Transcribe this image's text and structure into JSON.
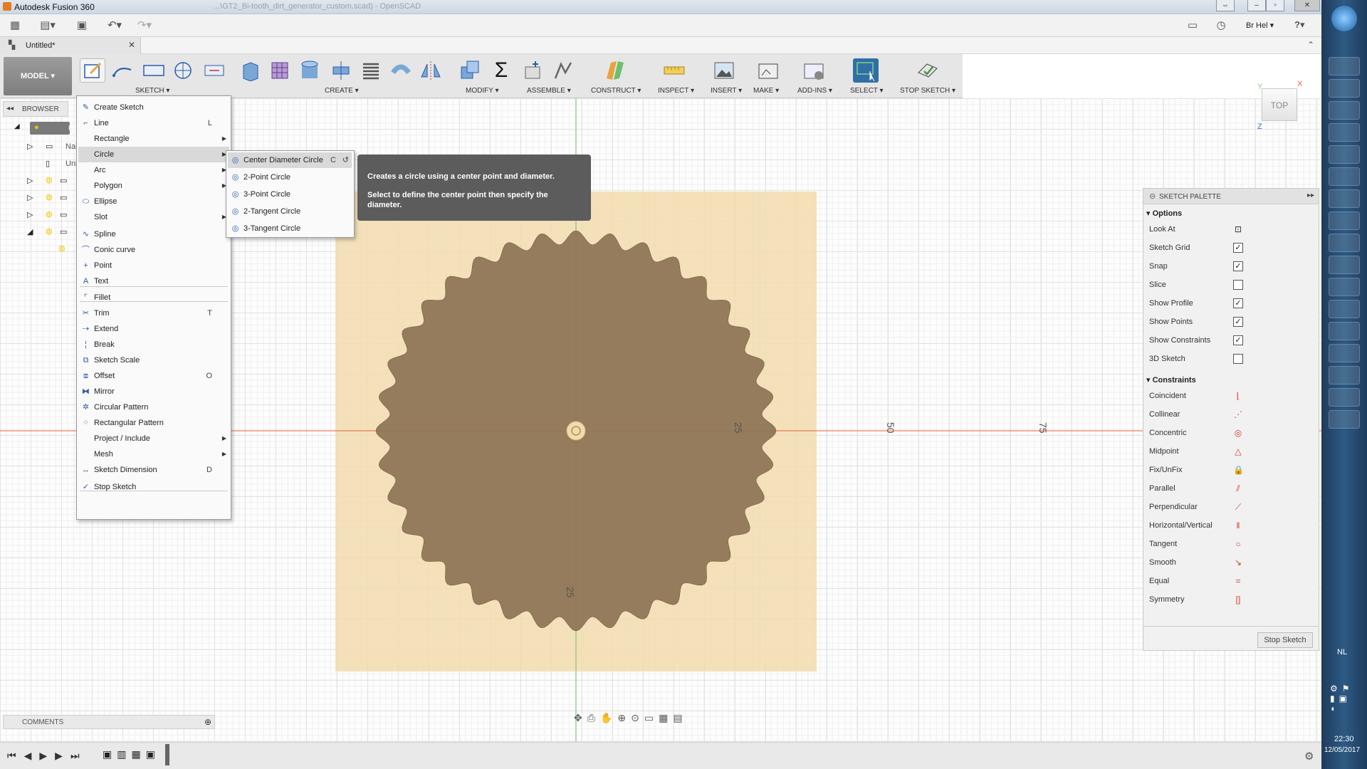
{
  "window": {
    "title": "Autodesk Fusion 360",
    "subtitle_faded": "...\\GT2_Bi-tooth_dirt_generator_custom.scad) - OpenSCAD",
    "restore_icon": "restore-icon",
    "minimize_icon": "minimize-icon",
    "maximize_icon": "maximize-icon",
    "close_icon": "close-icon"
  },
  "qat": {
    "user": "Br Hel ▾",
    "help": "?▾"
  },
  "document": {
    "tab": "Untitled*",
    "close": "✕"
  },
  "toolbar": {
    "workspace": "MODEL",
    "groups": [
      "SKETCH ▾",
      "CREATE ▾",
      "MODIFY ▾",
      "ASSEMBLE ▾",
      "CONSTRUCT ▾",
      "INSPECT ▾",
      "INSERT ▾",
      "MAKE ▾",
      "ADD-INS ▾",
      "SELECT ▾",
      "STOP SKETCH ▾"
    ]
  },
  "browser": {
    "title": "BROWSER",
    "row0": "(U",
    "row1": "Nai",
    "row2": "Uni"
  },
  "sketch_menu": {
    "items": [
      {
        "label": "Create Sketch",
        "shortcut": "",
        "icon": "create-sketch-icon"
      },
      {
        "label": "Line",
        "shortcut": "L",
        "icon": "line-icon"
      },
      {
        "label": "Rectangle",
        "shortcut": "",
        "icon": "",
        "submenu": true
      },
      {
        "label": "Circle",
        "shortcut": "",
        "icon": "",
        "submenu": true
      },
      {
        "label": "Arc",
        "shortcut": "",
        "icon": "",
        "submenu": true
      },
      {
        "label": "Polygon",
        "shortcut": "",
        "icon": "",
        "submenu": true
      },
      {
        "label": "Ellipse",
        "shortcut": "",
        "icon": "ellipse-icon"
      },
      {
        "label": "Slot",
        "shortcut": "",
        "icon": "",
        "submenu": true
      },
      {
        "label": "Spline",
        "shortcut": "",
        "icon": "spline-icon"
      },
      {
        "label": "Conic curve",
        "shortcut": "",
        "icon": "conic-curve-icon"
      },
      {
        "label": "Point",
        "shortcut": "",
        "icon": "point-icon"
      },
      {
        "label": "Text",
        "shortcut": "",
        "icon": "text-icon"
      },
      {
        "label": "Fillet",
        "shortcut": "",
        "icon": "fillet-icon"
      },
      {
        "label": "Trim",
        "shortcut": "T",
        "icon": "trim-icon"
      },
      {
        "label": "Extend",
        "shortcut": "",
        "icon": "extend-icon"
      },
      {
        "label": "Break",
        "shortcut": "",
        "icon": "break-icon"
      },
      {
        "label": "Sketch Scale",
        "shortcut": "",
        "icon": "sketch-scale-icon"
      },
      {
        "label": "Offset",
        "shortcut": "O",
        "icon": "offset-icon"
      },
      {
        "label": "Mirror",
        "shortcut": "",
        "icon": "mirror-icon"
      },
      {
        "label": "Circular Pattern",
        "shortcut": "",
        "icon": "circular-pattern-icon"
      },
      {
        "label": "Rectangular Pattern",
        "shortcut": "",
        "icon": "rectangular-pattern-icon"
      },
      {
        "label": "Project / Include",
        "shortcut": "",
        "icon": "",
        "submenu": true
      },
      {
        "label": "Mesh",
        "shortcut": "",
        "icon": "",
        "submenu": true
      },
      {
        "label": "Sketch Dimension",
        "shortcut": "D",
        "icon": "sketch-dimension-icon"
      },
      {
        "label": "Stop Sketch",
        "shortcut": "",
        "icon": "stop-sketch-icon"
      }
    ]
  },
  "circle_submenu": {
    "items": [
      {
        "label": "Center Diameter Circle",
        "shortcut": "C"
      },
      {
        "label": "2-Point Circle",
        "shortcut": ""
      },
      {
        "label": "3-Point Circle",
        "shortcut": ""
      },
      {
        "label": "2-Tangent Circle",
        "shortcut": ""
      },
      {
        "label": "3-Tangent Circle",
        "shortcut": ""
      }
    ]
  },
  "tooltip": {
    "title": "Creates a circle using a center point and diameter.",
    "body": "Select to define the center point then specify the diameter."
  },
  "viewcube": {
    "face": "TOP",
    "x": "X",
    "y": "Y",
    "z": "Z"
  },
  "canvas": {
    "dim_labels": [
      "25",
      "50",
      "75",
      "25"
    ],
    "gear_teeth": 36,
    "gear_color": "#8f7656",
    "plane_color": "#f2dcae",
    "axis_red": "#e8613c",
    "axis_green": "#6cc06c"
  },
  "palette": {
    "title": "SKETCH PALETTE",
    "options_header": "Options",
    "options": [
      {
        "label": "Look At",
        "type": "button",
        "icon": "look-at-icon"
      },
      {
        "label": "Sketch Grid",
        "type": "check",
        "checked": true
      },
      {
        "label": "Snap",
        "type": "check",
        "checked": true
      },
      {
        "label": "Slice",
        "type": "check",
        "checked": false
      },
      {
        "label": "Show Profile",
        "type": "check",
        "checked": true
      },
      {
        "label": "Show Points",
        "type": "check",
        "checked": true
      },
      {
        "label": "Show Constraints",
        "type": "check",
        "checked": true
      },
      {
        "label": "3D Sketch",
        "type": "check",
        "checked": false
      }
    ],
    "constraints_header": "Constraints",
    "constraints": [
      {
        "label": "Coincident",
        "icon": "coincident-icon"
      },
      {
        "label": "Collinear",
        "icon": "collinear-icon"
      },
      {
        "label": "Concentric",
        "icon": "concentric-icon"
      },
      {
        "label": "Midpoint",
        "icon": "midpoint-icon"
      },
      {
        "label": "Fix/UnFix",
        "icon": "fix-icon"
      },
      {
        "label": "Parallel",
        "icon": "parallel-icon"
      },
      {
        "label": "Perpendicular",
        "icon": "perpendicular-icon"
      },
      {
        "label": "Horizontal/Vertical",
        "icon": "horizontal-vertical-icon"
      },
      {
        "label": "Tangent",
        "icon": "tangent-icon"
      },
      {
        "label": "Smooth",
        "icon": "smooth-icon"
      },
      {
        "label": "Equal",
        "icon": "equal-icon"
      },
      {
        "label": "Symmetry",
        "icon": "symmetry-icon"
      }
    ],
    "stop_button": "Stop Sketch"
  },
  "comments": {
    "label": "COMMENTS"
  },
  "taskbar": {
    "lang": "NL",
    "time": "22:30",
    "date": "12/05/2017"
  },
  "colors": {
    "accent": "#2a5ca8",
    "menu_hover": "#d9d9d9",
    "tooltip_bg": "#5c5c5c"
  }
}
